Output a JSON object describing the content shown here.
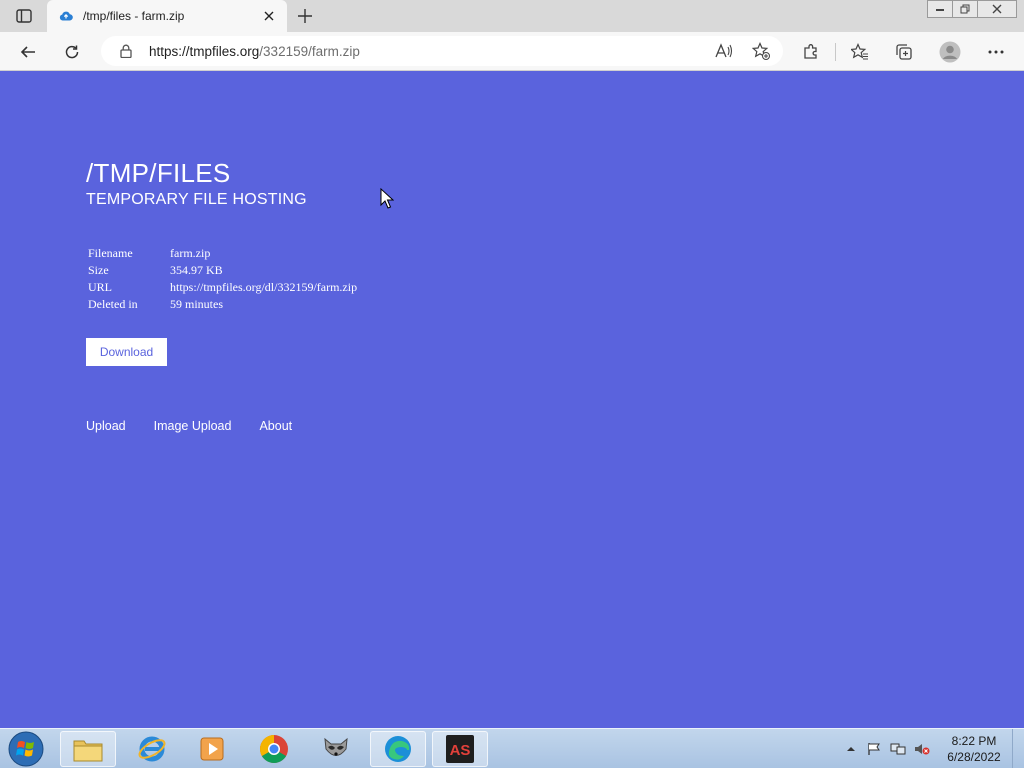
{
  "browser": {
    "tab_title": "/tmp/files - farm.zip",
    "address": {
      "host": "https://tmpfiles.org",
      "path": "/332159/farm.zip"
    }
  },
  "page": {
    "title": "/TMP/FILES",
    "subtitle": "TEMPORARY FILE HOSTING",
    "info": [
      {
        "label": "Filename",
        "value": "farm.zip"
      },
      {
        "label": "Size",
        "value": "354.97 KB"
      },
      {
        "label": "URL",
        "value": "https://tmpfiles.org/dl/332159/farm.zip"
      },
      {
        "label": "Deleted in",
        "value": "59 minutes"
      }
    ],
    "download_label": "Download",
    "nav": [
      "Upload",
      "Image Upload",
      "About"
    ],
    "background_color": "#5a63dd"
  },
  "taskbar": {
    "time": "8:22 PM",
    "date": "6/28/2022",
    "pinned_icons": [
      "explorer-icon",
      "internet-explorer-icon",
      "media-player-icon",
      "chrome-icon",
      "raccoon-app-icon",
      "edge-icon",
      "as-app-icon"
    ]
  }
}
